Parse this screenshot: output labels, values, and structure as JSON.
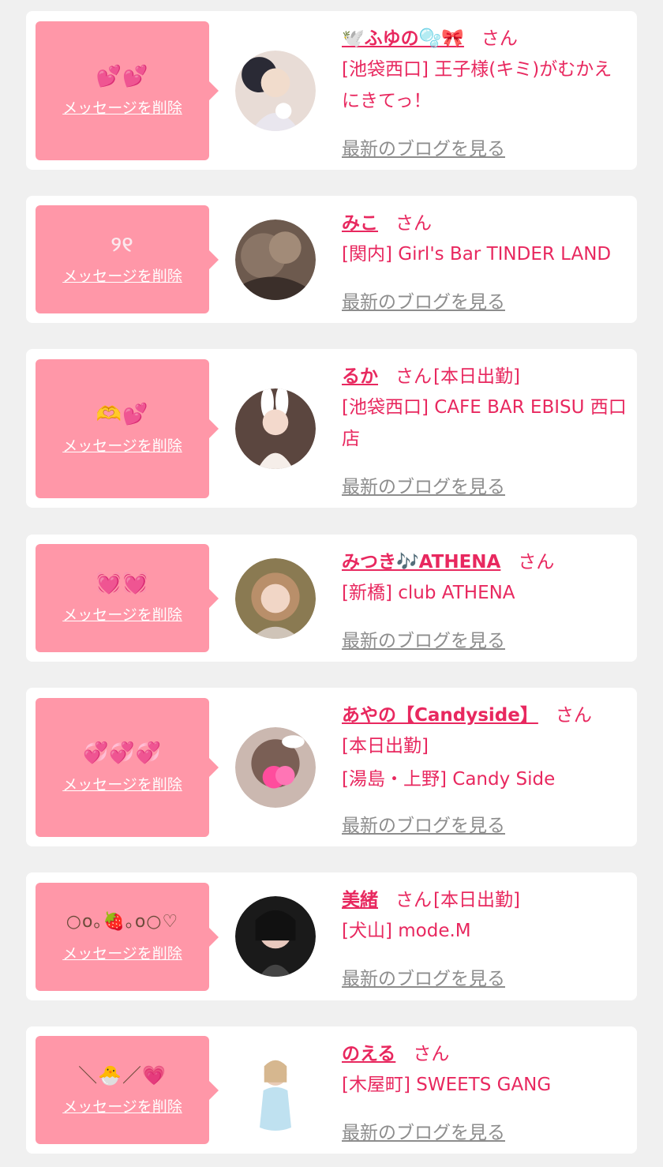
{
  "messages": [
    {
      "message_text": "💕💕",
      "delete_label": "メッセージを削除",
      "name": "🕊️ふゆの🫧🎀",
      "honorific": "さん",
      "status": "",
      "shop": "[池袋西口] 王子様(キミ)がむかえにきてっ！",
      "blog_label": "最新のブログを見る"
    },
    {
      "message_text": "୨୧",
      "delete_label": "メッセージを削除",
      "name": "みこ",
      "honorific": "さん",
      "status": "",
      "shop": "[関内] Girl's Bar TINDER LAND",
      "blog_label": "最新のブログを見る"
    },
    {
      "message_text": "🫶💕",
      "delete_label": "メッセージを削除",
      "name": "るか",
      "honorific": "さん",
      "status": "[本日出勤]",
      "shop": "[池袋西口] CAFE BAR EBISU 西口店",
      "blog_label": "最新のブログを見る"
    },
    {
      "message_text": "💓💓",
      "delete_label": "メッセージを削除",
      "name": "みつき🎶ATHENA",
      "honorific": "さん",
      "status": "",
      "shop": "[新橋] club ATHENA",
      "blog_label": "最新のブログを見る"
    },
    {
      "message_text": "💞💞💞",
      "delete_label": "メッセージを削除",
      "name": "あやの【Candyside】",
      "honorific": "さん",
      "status": "[本日出勤]",
      "shop": "[湯島・上野] Candy Side",
      "blog_label": "最新のブログを見る"
    },
    {
      "message_text": "○o｡🍓｡o○♡",
      "delete_label": "メッセージを削除",
      "name": "美緒",
      "honorific": "さん",
      "status": "[本日出勤]",
      "shop": "[犬山] mode.M",
      "blog_label": "最新のブログを見る"
    },
    {
      "message_text": "＼🐣／💗",
      "delete_label": "メッセージを削除",
      "name": "のえる",
      "honorific": "さん",
      "status": "",
      "shop": "[木屋町] SWEETS GANG",
      "blog_label": "最新のブログを見る"
    }
  ],
  "colors": {
    "background": "#f0f0f0",
    "card": "#ffffff",
    "bubble": "#ff97a8",
    "accent": "#e8285f",
    "blog_link": "#8d8d8d"
  }
}
